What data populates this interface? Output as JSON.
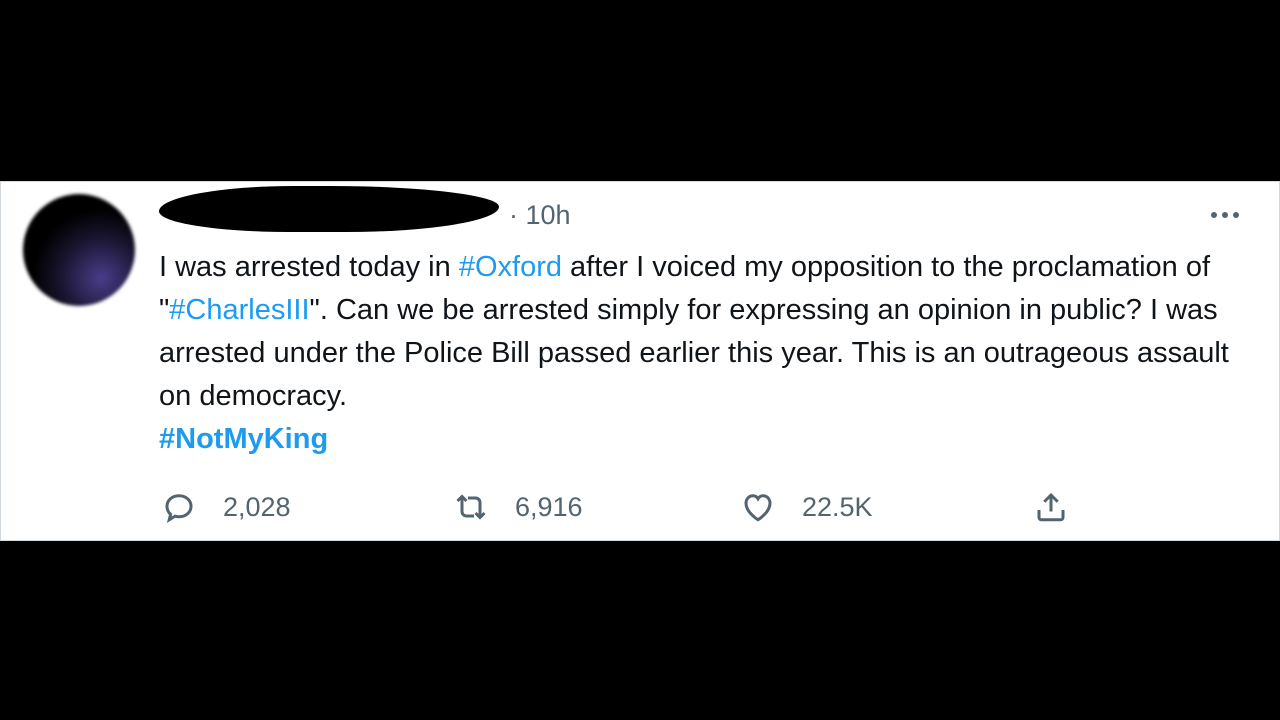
{
  "tweet": {
    "timestamp": "· 10h",
    "text_segments": [
      {
        "text": "I was arrested today in ",
        "type": "plain"
      },
      {
        "text": "#Oxford",
        "type": "hashtag"
      },
      {
        "text": " after I voiced my opposition to the proclamation of \"",
        "type": "plain"
      },
      {
        "text": "#CharlesIII",
        "type": "hashtag"
      },
      {
        "text": "\". Can we be arrested simply for expressing an opinion in public? I was arrested under the Police Bill passed earlier this year. This is an outrageous assault on democracy.",
        "type": "plain"
      }
    ],
    "final_hashtag": "#NotMyKing",
    "reply_count": "2,028",
    "retweet_count": "6,916",
    "like_count": "22.5K",
    "icons": {
      "reply": "reply-icon",
      "retweet": "retweet-icon",
      "like": "heart-icon",
      "share": "share-icon",
      "more": "more-icon"
    },
    "colors": {
      "hashtag": "#1d9bf0",
      "text": "#0f1419",
      "muted": "#536471"
    }
  }
}
